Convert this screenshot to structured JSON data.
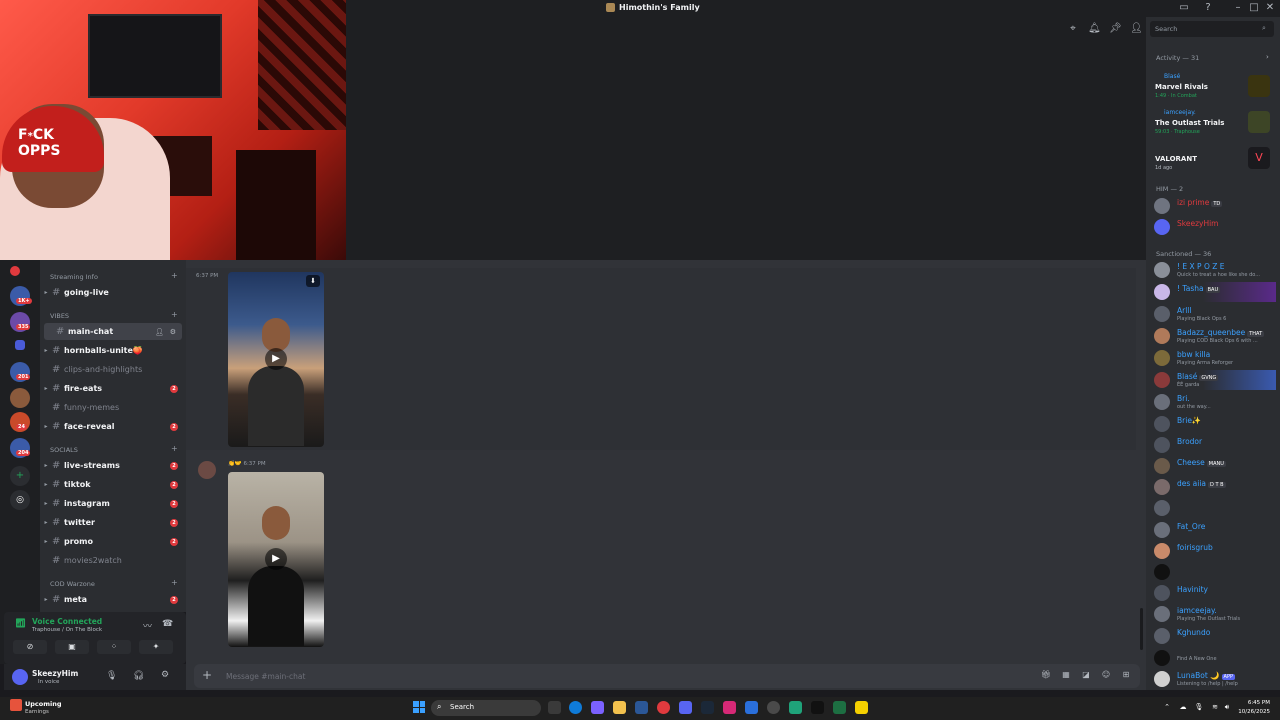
{
  "window": {
    "title": "Himothin's Family"
  },
  "sidebar": {
    "categories": {
      "streaming": "Streaming Info",
      "vibes": "VIBES",
      "socials": "SOCIALS",
      "cod": "COD Warzone"
    },
    "guild_badges": [
      "1K+",
      "335",
      "201",
      "24",
      "204"
    ],
    "channels": [
      {
        "name": "going-live",
        "badge": ""
      },
      {
        "name": "main-chat",
        "badge": ""
      },
      {
        "name": "hornballs-unite🍑",
        "badge": ""
      },
      {
        "name": "clips-and-highlights",
        "badge": ""
      },
      {
        "name": "fire-eats",
        "badge": "2"
      },
      {
        "name": "funny-memes",
        "badge": ""
      },
      {
        "name": "face-reveal",
        "badge": "2"
      },
      {
        "name": "live-streams",
        "badge": "2"
      },
      {
        "name": "tiktok",
        "badge": "2"
      },
      {
        "name": "instagram",
        "badge": "2"
      },
      {
        "name": "twitter",
        "badge": "2"
      },
      {
        "name": "promo",
        "badge": "2"
      },
      {
        "name": "movies2watch",
        "badge": ""
      },
      {
        "name": "meta",
        "badge": "2"
      }
    ]
  },
  "voice": {
    "title": "Voice Connected",
    "subtitle": "Traphouse / On The Block"
  },
  "user": {
    "name": "SkeezyHim",
    "status": "In voice"
  },
  "chat": {
    "messages": [
      {
        "time": "6:37 PM"
      },
      {
        "time": "6:37 PM"
      }
    ],
    "composer_placeholder": "Message #main-chat"
  },
  "members": {
    "search_placeholder": "Search",
    "activity_header": "Activity — 31",
    "activities": [
      {
        "user": "Blasé",
        "game": "Marvel Rivals",
        "meta": "1:49 · In Combat"
      },
      {
        "user": "iamceejay.",
        "game": "The Outlast Trials",
        "meta": "59:03 · Traphouse"
      },
      {
        "user": "",
        "game": "VALORANT",
        "meta": "1d ago"
      }
    ],
    "him_header": "HIM — 2",
    "him": [
      {
        "name": "izi prime",
        "tag": "TD",
        "sub": ""
      },
      {
        "name": "SkeezyHim",
        "tag": "",
        "sub": ""
      }
    ],
    "sanctioned_header": "Sanctioned — 36",
    "sanctioned": [
      {
        "name": "! E X P O Z E",
        "tag": "",
        "sub": "Quick to treat a hoe like she do..."
      },
      {
        "name": "! Tasha",
        "tag": "BAU",
        "sub": ""
      },
      {
        "name": "Arlll",
        "tag": "",
        "sub": "Playing Black Ops 6"
      },
      {
        "name": "Badazz_queenbee",
        "tag": "THAT",
        "sub": "Playing COD Black Ops 6 with ..."
      },
      {
        "name": "bbw killa",
        "tag": "",
        "sub": "Playing Arma Reforger"
      },
      {
        "name": "Blasé",
        "tag": "GVNG",
        "sub": "ÉÉ garda"
      },
      {
        "name": "Bri.",
        "tag": "",
        "sub": "out the way..."
      },
      {
        "name": "Brie✨",
        "tag": "",
        "sub": ""
      },
      {
        "name": "Brodor",
        "tag": "",
        "sub": ""
      },
      {
        "name": "Cheese",
        "tag": "MANU",
        "sub": ""
      },
      {
        "name": "des aiia",
        "tag": "D T B",
        "sub": ""
      },
      {
        "name": "Fat_Ore",
        "tag": "",
        "sub": ""
      },
      {
        "name": "foirisgrub",
        "tag": "",
        "sub": ""
      },
      {
        "name": "Havinity",
        "tag": "",
        "sub": ""
      },
      {
        "name": "iamceejay.",
        "tag": "",
        "sub": "Playing The Outlast Trials"
      },
      {
        "name": "Kghundo",
        "tag": "",
        "sub": ""
      },
      {
        "name": "",
        "tag": "",
        "sub": "Find A New One"
      },
      {
        "name": "LunaBot 🌙",
        "tag": "APP",
        "sub": "Listening to /help | /help"
      }
    ]
  },
  "taskbar": {
    "upcoming": "Upcoming",
    "earnings": "Earnings",
    "search": "Search",
    "time": "6:45 PM",
    "date": "10/26/2025"
  },
  "colors": {
    "accent": "#5865f2",
    "online": "#23a55a",
    "badge": "#e03a3e",
    "link": "#3ba1ff"
  }
}
